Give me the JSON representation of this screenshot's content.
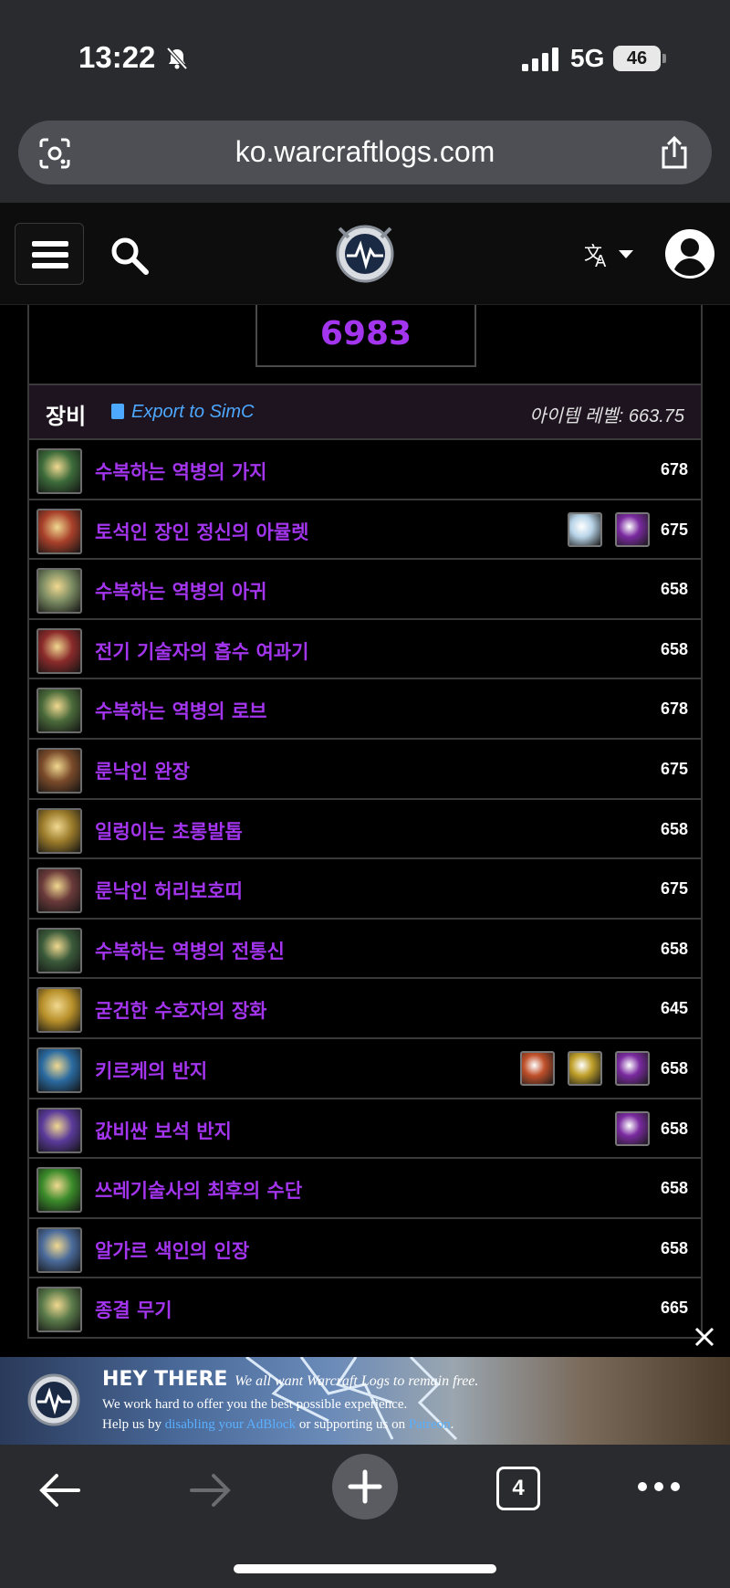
{
  "status_bar": {
    "time": "13:22",
    "network": "5G",
    "battery": "46"
  },
  "browser": {
    "url": "ko.warcraftlogs.com",
    "tab_count": "4"
  },
  "score": "6983",
  "gear": {
    "title": "장비",
    "export_label": "Export to SimC",
    "item_level_label": "아이템 레벨: 663.75",
    "items": [
      {
        "name": "수복하는 역병의 가지",
        "level": "678",
        "icon_color": "#3c6b3a"
      },
      {
        "name": "토석인 장인 정신의 아뮬렛",
        "level": "675",
        "icon_color": "#a8402a",
        "gems": [
          "#b8d4e8",
          "#7a2aa0"
        ]
      },
      {
        "name": "수복하는 역병의 아귀",
        "level": "658",
        "icon_color": "#7a8a62"
      },
      {
        "name": "전기 기술자의 흡수 여과기",
        "level": "658",
        "icon_color": "#8a2a2a"
      },
      {
        "name": "수복하는 역병의 로브",
        "level": "678",
        "icon_color": "#4a6a3a"
      },
      {
        "name": "룬낙인 완장",
        "level": "675",
        "icon_color": "#7a4a2a"
      },
      {
        "name": "일렁이는 초롱발톱",
        "level": "658",
        "icon_color": "#9a7a2a"
      },
      {
        "name": "룬낙인 허리보호띠",
        "level": "675",
        "icon_color": "#6a3a3a"
      },
      {
        "name": "수복하는 역병의 전통신",
        "level": "658",
        "icon_color": "#3a5a3a"
      },
      {
        "name": "굳건한 수호자의 장화",
        "level": "645",
        "icon_color": "#b8902a"
      },
      {
        "name": "키르케의 반지",
        "level": "658",
        "icon_color": "#2a6aa0",
        "gems": [
          "#c0502a",
          "#c0a02a",
          "#7a2aa0"
        ]
      },
      {
        "name": "값비싼 보석 반지",
        "level": "658",
        "icon_color": "#5a3a9a",
        "gems": [
          "#7a2aa0"
        ]
      },
      {
        "name": "쓰레기술사의 최후의 수단",
        "level": "658",
        "icon_color": "#3a8a2a"
      },
      {
        "name": "알가르 색인의 인장",
        "level": "658",
        "icon_color": "#4a6a9a"
      },
      {
        "name": "종결 무기",
        "level": "665",
        "icon_color": "#5a7a4a"
      }
    ]
  },
  "ad": {
    "heading": "HEY THERE",
    "tagline": "We all want Warcraft Logs to remain free.",
    "line1": "We work hard to offer you the best possible experience.",
    "line2_a": "Help us by ",
    "line2_link1": "disabling your AdBlock",
    "line2_b": " or supporting us on ",
    "line2_link2": "Patreon",
    "line2_c": "."
  }
}
